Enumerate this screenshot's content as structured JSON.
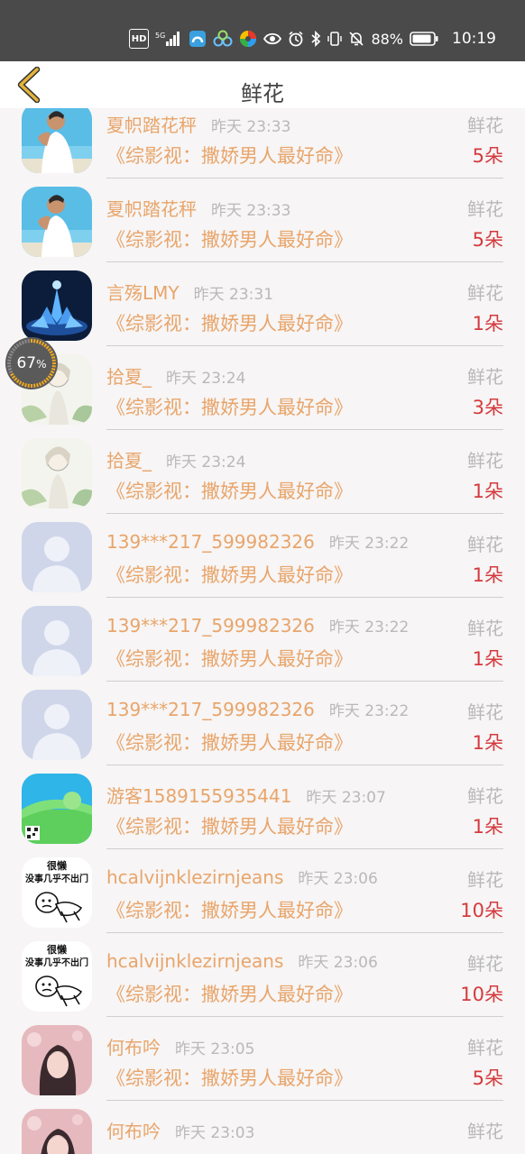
{
  "status_bar": {
    "hd_label": "HD",
    "network_label": "5G",
    "battery_percent": "88%",
    "time": "10:19",
    "icons": [
      "hd-badge",
      "signal-5g-icon",
      "app-icon-blue",
      "app-icon-clouds",
      "app-icon-colorful",
      "eye-icon",
      "alarm-icon",
      "bluetooth-icon",
      "vibrate-icon",
      "mute-bell-icon",
      "battery-icon"
    ]
  },
  "nav": {
    "title": "鲜花",
    "back_icon": "chevron-left-icon",
    "accent": "#e4b43a"
  },
  "floating_progress": {
    "value": 67,
    "unit": "%"
  },
  "colors": {
    "name": "#e8a56b",
    "time": "#b9b9b9",
    "count": "#d53a3e"
  },
  "list": {
    "rows": [
      {
        "name": "夏帜踏花秤",
        "time": "昨天 23:33",
        "type": "鲜花",
        "book": "《综影视：撒娇男人最好命》",
        "count": "5朵",
        "avatar": "beach-man"
      },
      {
        "name": "夏帜踏花秤",
        "time": "昨天 23:33",
        "type": "鲜花",
        "book": "《综影视：撒娇男人最好命》",
        "count": "5朵",
        "avatar": "beach-man"
      },
      {
        "name": "言殇LMY",
        "time": "昨天 23:31",
        "type": "鲜花",
        "book": "《综影视：撒娇男人最好命》",
        "count": "1朵",
        "avatar": "blue-lotus"
      },
      {
        "name": "拾夏_",
        "time": "昨天 23:24",
        "type": "鲜花",
        "book": "《综影视：撒娇男人最好命》",
        "count": "3朵",
        "avatar": "anime-sketch"
      },
      {
        "name": "拾夏_",
        "time": "昨天 23:24",
        "type": "鲜花",
        "book": "《综影视：撒娇男人最好命》",
        "count": "1朵",
        "avatar": "anime-sketch"
      },
      {
        "name": "139***217_599982326",
        "time": "昨天 23:22",
        "type": "鲜花",
        "book": "《综影视：撒娇男人最好命》",
        "count": "1朵",
        "avatar": "default-person"
      },
      {
        "name": "139***217_599982326",
        "time": "昨天 23:22",
        "type": "鲜花",
        "book": "《综影视：撒娇男人最好命》",
        "count": "1朵",
        "avatar": "default-person"
      },
      {
        "name": "139***217_599982326",
        "time": "昨天 23:22",
        "type": "鲜花",
        "book": "《综影视：撒娇男人最好命》",
        "count": "1朵",
        "avatar": "default-person"
      },
      {
        "name": "游客1589155935441",
        "time": "昨天 23:07",
        "type": "鲜花",
        "book": "《综影视：撒娇男人最好命》",
        "count": "1朵",
        "avatar": "green-scene"
      },
      {
        "name": "hcalvijnklezirnjeans",
        "time": "昨天 23:06",
        "type": "鲜花",
        "book": "《综影视：撒娇男人最好命》",
        "count": "10朵",
        "avatar": "meme",
        "avatar_text_1": "很懒",
        "avatar_text_2": "没事几乎不出门"
      },
      {
        "name": "hcalvijnklezirnjeans",
        "time": "昨天 23:06",
        "type": "鲜花",
        "book": "《综影视：撒娇男人最好命》",
        "count": "10朵",
        "avatar": "meme",
        "avatar_text_1": "很懒",
        "avatar_text_2": "没事几乎不出门"
      },
      {
        "name": "何布吟",
        "time": "昨天 23:05",
        "type": "鲜花",
        "book": "《综影视：撒娇男人最好命》",
        "count": "5朵",
        "avatar": "pink-girl"
      },
      {
        "name": "何布吟",
        "time": "昨天 23:03",
        "type": "鲜花",
        "book": "",
        "count": "",
        "avatar": "pink-girl"
      }
    ]
  }
}
